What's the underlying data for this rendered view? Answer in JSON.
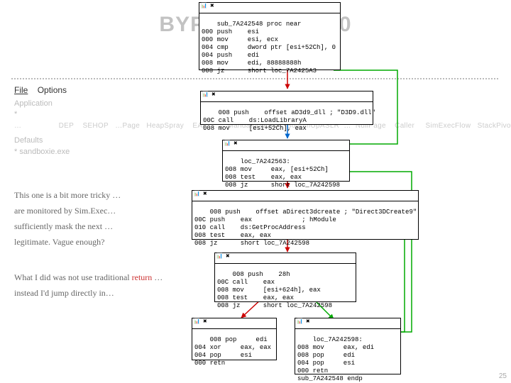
{
  "title": "BYPASS … ET 4.0",
  "title_full": "BYPASS SANDBOXIE / EMET 4.0",
  "menu": {
    "file": "File",
    "options": "Options"
  },
  "sub1": "Application",
  "sub2": "*",
  "row_items": [
    "…",
    "DEP",
    "SEHOP",
    "…Page",
    "HeapSpray",
    "EAF",
    "…",
    "MandatoryASLR",
    "BottomUpASLR",
    "…",
    "NullPage",
    "Caller",
    "SimExecFlow",
    "StackPivot"
  ],
  "sub3": "Defaults",
  "sub4": "* sandboxie.exe",
  "para1_a": "This one is a bit more tricky …",
  "para1_b": "are monitored by Sim.Exec…",
  "para1_c": "sufficiently mask the next …",
  "para1_d": "legitimate. Vague enough?",
  "para2_a": "What I did was not use traditional",
  "para2_a_red": " return ",
  "para2_a2": "…",
  "para2_b": "instead I'd jump directly in…",
  "asm": {
    "b1": {
      "head": "sub_7A242548 proc near",
      "l": [
        "000 push    esi",
        "000 mov     esi, ecx",
        "004 cmp     dword ptr [esi+52Ch], 0",
        "004 push    edi",
        "008 mov     edi, 88888888h",
        "008 jz      short loc_7A2425A3"
      ]
    },
    "b2": {
      "l": [
        "008 push    offset aD3d9_dll ; \"D3D9.dll\"",
        "00C call    ds:LoadLibraryA",
        "008 mov     [esi+52Ch], eax"
      ]
    },
    "b3": {
      "head": "loc_7A242563:",
      "l": [
        "008 mov     eax, [esi+52Ch]",
        "008 test    eax, eax",
        "008 jz      short loc_7A242598"
      ]
    },
    "b4": {
      "l": [
        "008 push    offset aDirect3dcreate ; \"Direct3DCreate9\"",
        "00C push    eax             ; hModule",
        "010 call    ds:GetProcAddress",
        "008 test    eax, eax",
        "008 jz      short loc_7A242598"
      ]
    },
    "b5": {
      "l": [
        "008 push    28h",
        "00C call    eax",
        "008 mov     [esi+624h], eax",
        "008 test    eax, eax",
        "008 jz      short loc_7A242598"
      ]
    },
    "b6": {
      "l": [
        "008 pop     edi",
        "004 xor     eax, eax",
        "004 pop     esi",
        "000 retn"
      ]
    },
    "b7": {
      "head": "loc_7A242598:",
      "l": [
        "008 mov     eax, edi",
        "008 pop     edi",
        "004 pop     esi",
        "000 retn",
        "sub_7A242548 endp"
      ]
    }
  }
}
